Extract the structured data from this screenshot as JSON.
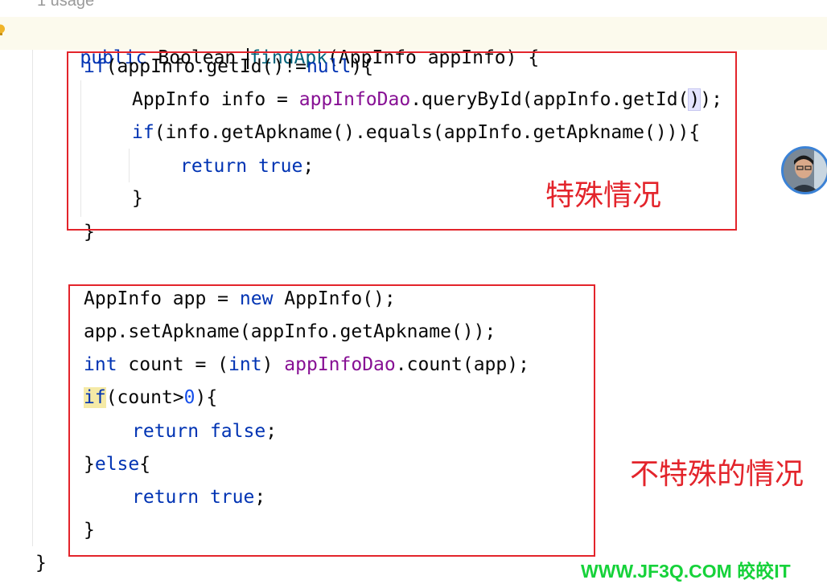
{
  "editor": {
    "usage_hint": "1 usage",
    "signature": {
      "modifier": "public",
      "return_type": "Boolean",
      "method_name": "findApk",
      "params": "(AppInfo appInfo) {"
    },
    "block1": {
      "if_kw": "if",
      "cond_a": "(appInfo.getId()!=",
      "null_kw": "null",
      "cond_b": "){",
      "l2_a": "AppInfo info = ",
      "l2_field": "appInfoDao",
      "l2_b": ".queryById(appInfo.getId(",
      "l2_paren": ")",
      "l2_c": ");",
      "l3_if": "if",
      "l3_a": "(info.getApkname().equals(appInfo.getApkname()))",
      "l3_brace": "{",
      "l4_return": "return",
      "l4_true": "true",
      "l4_semi": ";",
      "l5_close": "}",
      "l6_close": "}"
    },
    "block2": {
      "l1_a": "AppInfo app = ",
      "l1_new": "new",
      "l1_b": " AppInfo();",
      "l2": "app.setApkname(appInfo.getApkname());",
      "l3_int": "int",
      "l3_a": " count = (",
      "l3_int2": "int",
      "l3_b": ") ",
      "l3_field": "appInfoDao",
      "l3_c": ".count(app);",
      "l4_if": "if",
      "l4_a": "(count>",
      "l4_num": "0",
      "l4_b": "){",
      "l5_return": "return",
      "l5_false": "false",
      "l5_semi": ";",
      "l6_a": "}",
      "l6_else": "else",
      "l6_b": "{",
      "l7_return": "return",
      "l7_true": "true",
      "l7_semi": ";",
      "l8_close": "}"
    },
    "final_close": "}"
  },
  "annotations": {
    "special_case": "特殊情况",
    "non_special_case": "不特殊的情况"
  },
  "watermark": "WWW.JF3Q.COM 皎皎IT",
  "colors": {
    "keyword": "#0033b3",
    "field": "#871094",
    "number": "#1750eb",
    "method_decl": "#00627a",
    "annotation_red": "#e3242b",
    "watermark_green": "#16d23a"
  },
  "icons": {
    "gutter": "lightbulb-icon",
    "avatar": "user-avatar"
  }
}
